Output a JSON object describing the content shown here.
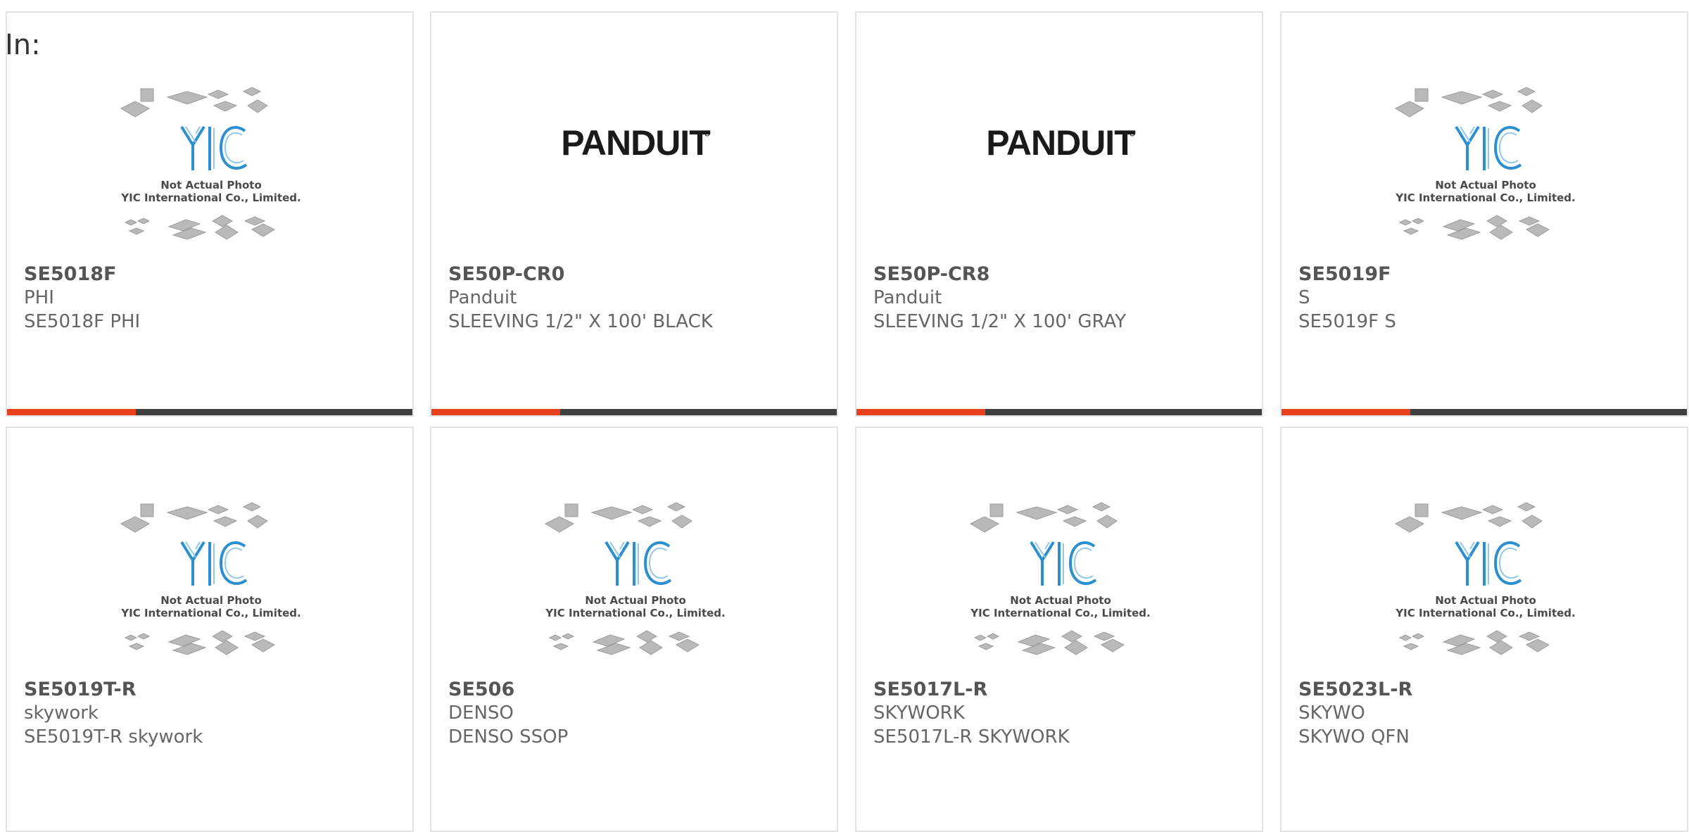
{
  "prefix_text": "In:",
  "accent_color": "#e8401c",
  "placeholder_image": {
    "icon": "yic-logo-icon",
    "line1": "Not Actual Photo",
    "line2": "YIC International Co., Limited."
  },
  "brand_logo": {
    "icon": "panduit-logo-icon",
    "text": "PANDUIT"
  },
  "products": [
    {
      "part_number": "SE5018F",
      "manufacturer": "PHI",
      "description": "SE5018F PHI",
      "image": "placeholder"
    },
    {
      "part_number": "SE50P-CR0",
      "manufacturer": "Panduit",
      "description": "SLEEVING 1/2\" X 100' BLACK",
      "image": "brand"
    },
    {
      "part_number": "SE50P-CR8",
      "manufacturer": "Panduit",
      "description": "SLEEVING 1/2\" X 100' GRAY",
      "image": "brand"
    },
    {
      "part_number": "SE5019F",
      "manufacturer": "S",
      "description": "SE5019F S",
      "image": "placeholder"
    },
    {
      "part_number": "SE5019T-R",
      "manufacturer": "skywork",
      "description": "SE5019T-R skywork",
      "image": "placeholder"
    },
    {
      "part_number": "SE506",
      "manufacturer": "DENSO",
      "description": "DENSO SSOP",
      "image": "placeholder"
    },
    {
      "part_number": "SE5017L-R",
      "manufacturer": "SKYWORK",
      "description": "SE5017L-R SKYWORK",
      "image": "placeholder"
    },
    {
      "part_number": "SE5023L-R",
      "manufacturer": "SKYWO",
      "description": "SKYWO QFN",
      "image": "placeholder"
    }
  ]
}
